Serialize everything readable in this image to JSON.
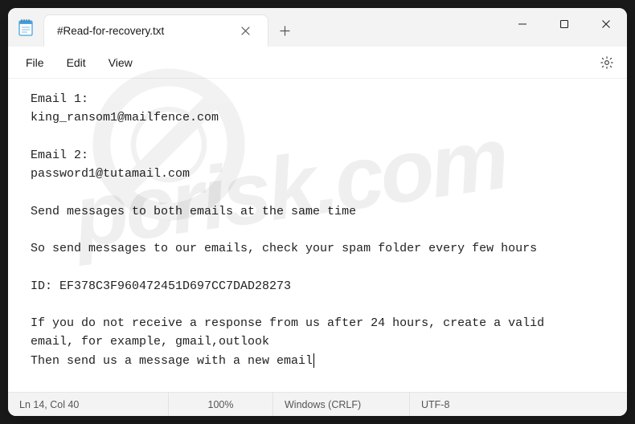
{
  "tab": {
    "title": "#Read-for-recovery.txt"
  },
  "menu": {
    "file": "File",
    "edit": "Edit",
    "view": "View"
  },
  "content": {
    "lines": [
      "Email 1:",
      "king_ransom1@mailfence.com",
      "",
      "Email 2:",
      "password1@tutamail.com",
      "",
      "Send messages to both emails at the same time",
      "",
      "So send messages to our emails, check your spam folder every few hours",
      "",
      "ID: EF378C3F960472451D697CC7DAD28273",
      "",
      "If you do not receive a response from us after 24 hours, create a valid",
      "email, for example, gmail,outlook",
      "Then send us a message with a new email"
    ]
  },
  "status": {
    "cursor": "Ln 14, Col 40",
    "zoom": "100%",
    "eol": "Windows (CRLF)",
    "encoding": "UTF-8"
  }
}
